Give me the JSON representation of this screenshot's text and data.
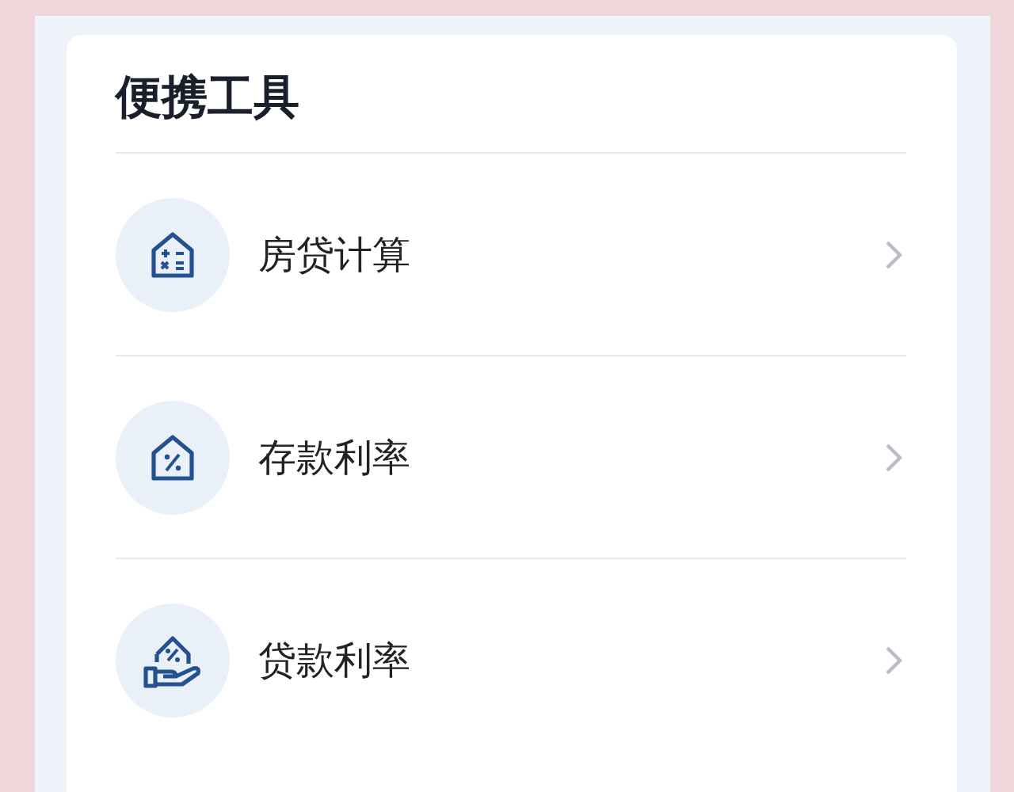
{
  "card": {
    "title": "便携工具",
    "items": [
      {
        "label": "房贷计算"
      },
      {
        "label": "存款利率"
      },
      {
        "label": "贷款利率"
      }
    ]
  }
}
